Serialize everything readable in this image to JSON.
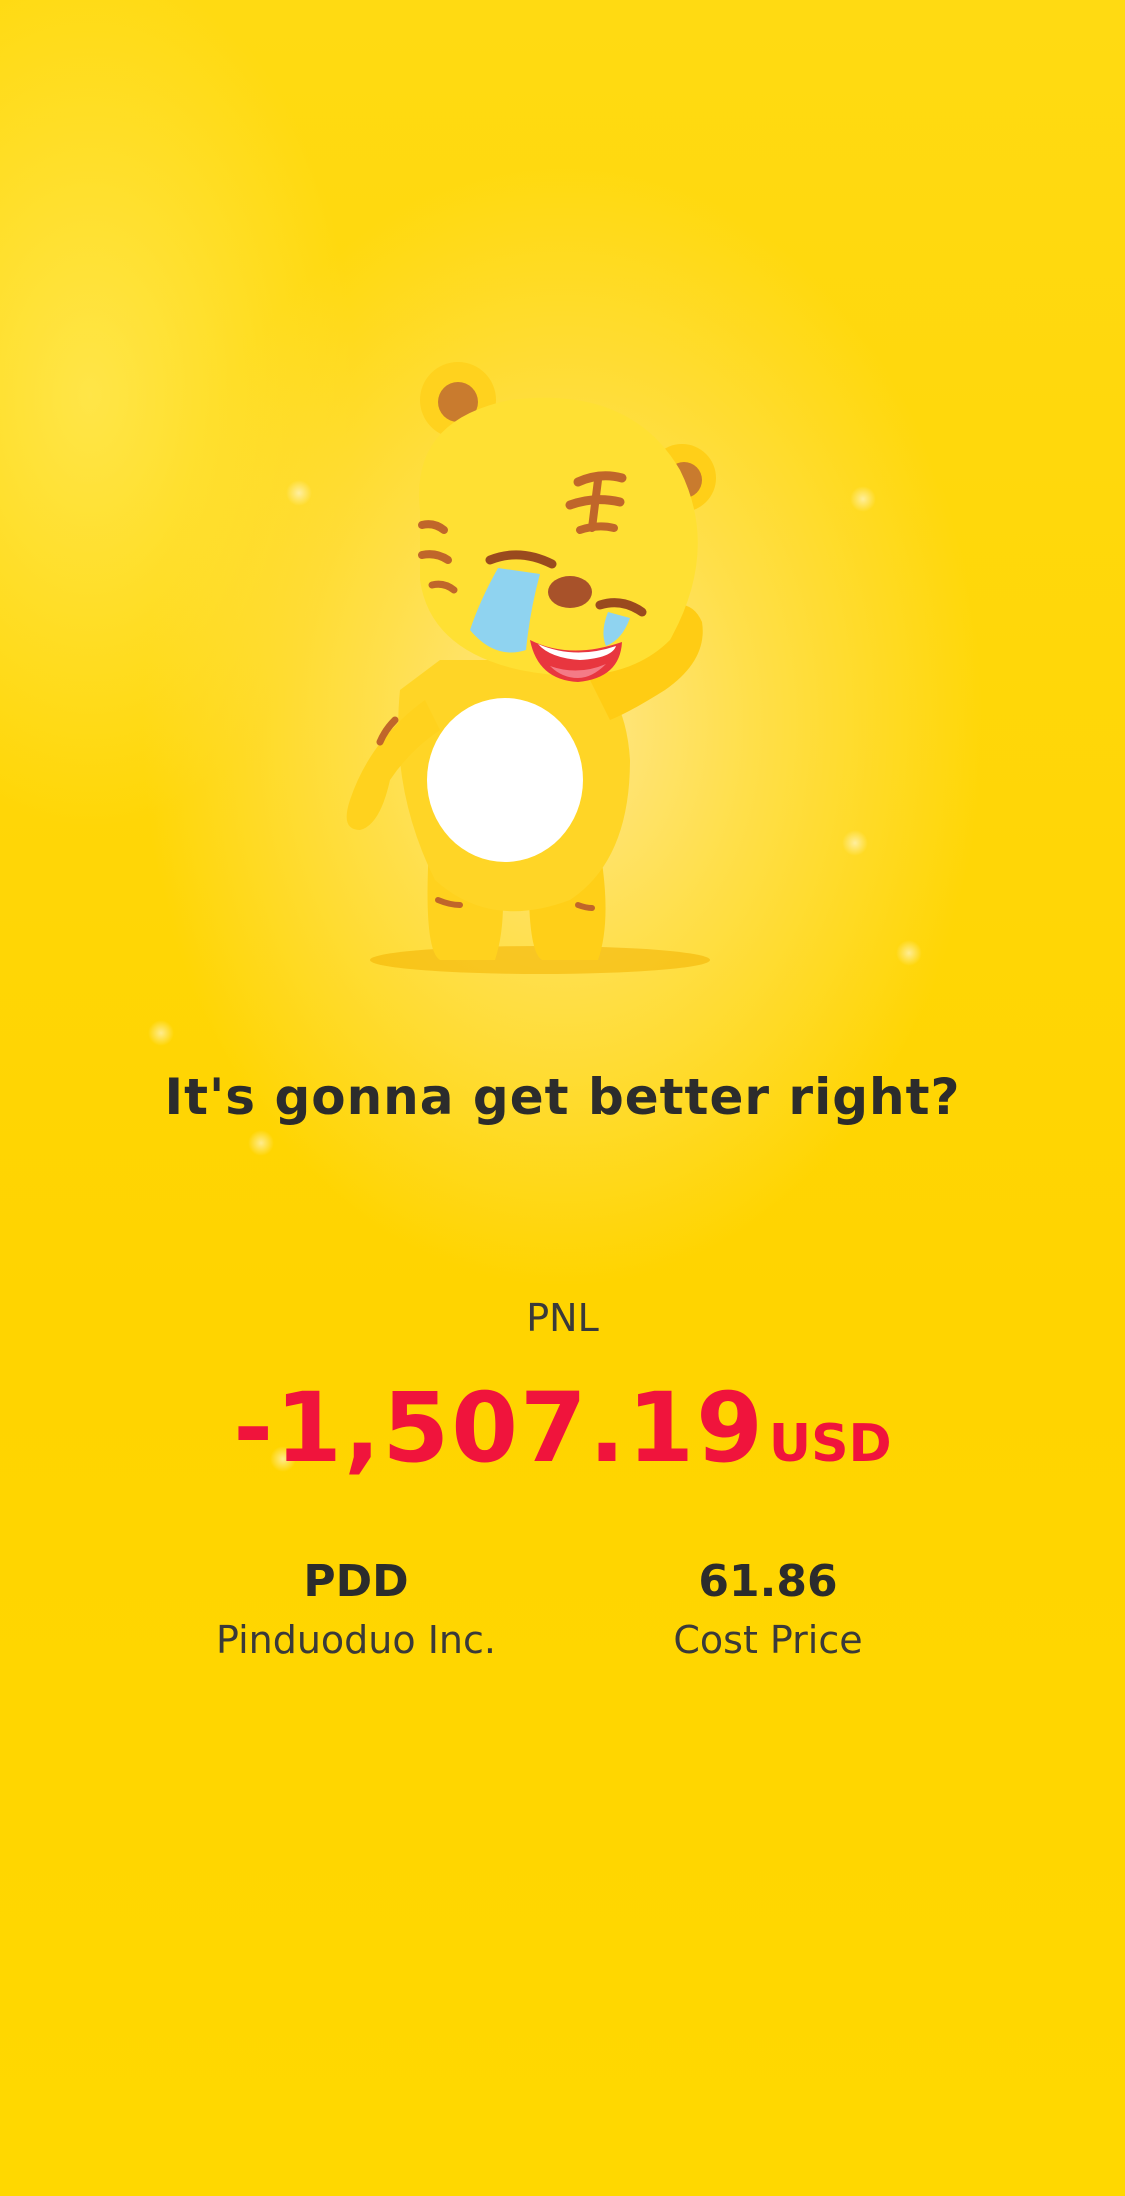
{
  "headline": "It's gonna get better right?",
  "mascot": {
    "icon": "crying-tiger-mascot-icon"
  },
  "pnl": {
    "label": "PNL",
    "value": "-1,507.19",
    "unit": "USD",
    "value_color": "#F0143C"
  },
  "stock": {
    "ticker": "PDD",
    "name": "Pinduoduo Inc."
  },
  "cost": {
    "value": "61.86",
    "label": "Cost Price"
  },
  "colors": {
    "background": "#FFD60A",
    "text": "#2C2C2C"
  }
}
